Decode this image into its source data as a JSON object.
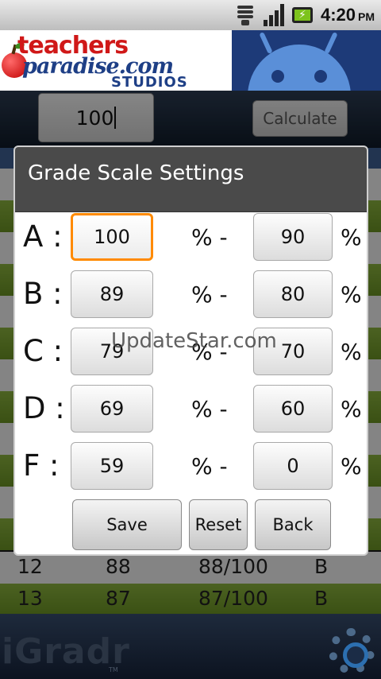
{
  "status_bar": {
    "time": "4:20",
    "ampm": "PM"
  },
  "banner": {
    "logo_line1": "teachers",
    "logo_line2": "paradise.com",
    "logo_line3": "STUDIOS"
  },
  "calculator": {
    "score_value": "100",
    "calculate_label": "Calculate"
  },
  "background_table": {
    "rows": [
      {
        "num": "12",
        "score": "88",
        "fraction": "88/100",
        "grade": "B"
      },
      {
        "num": "13",
        "score": "87",
        "fraction": "87/100",
        "grade": "B"
      }
    ]
  },
  "dialog": {
    "title": "Grade Scale Settings",
    "percent": "%",
    "dash": "% -",
    "grades": [
      {
        "letter": "A :",
        "max": "100",
        "min": "90"
      },
      {
        "letter": "B :",
        "max": "89",
        "min": "80"
      },
      {
        "letter": "C :",
        "max": "79",
        "min": "70"
      },
      {
        "letter": "D :",
        "max": "69",
        "min": "60"
      },
      {
        "letter": "F :",
        "max": "59",
        "min": "0"
      }
    ],
    "save_label": "Save",
    "reset_label": "Reset",
    "back_label": "Back"
  },
  "watermark": "UpdateStar.com",
  "app_name": "iGradr",
  "tm": "TM",
  "colors": {
    "focus_border": "#ff8a00",
    "row_green": "#7aa230",
    "dialog_title_bg": "#4a4a4a"
  }
}
